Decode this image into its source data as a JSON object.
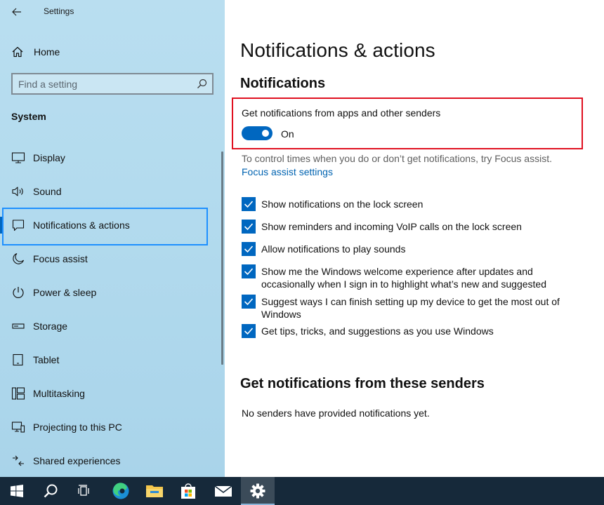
{
  "window": {
    "title": "Settings"
  },
  "sidebar": {
    "home_label": "Home",
    "search_placeholder": "Find a setting",
    "section_label": "System",
    "items": [
      {
        "label": "Display",
        "icon": "monitor-icon"
      },
      {
        "label": "Sound",
        "icon": "speaker-icon"
      },
      {
        "label": "Notifications & actions",
        "icon": "notification-icon",
        "selected": true
      },
      {
        "label": "Focus assist",
        "icon": "moon-icon"
      },
      {
        "label": "Power & sleep",
        "icon": "power-icon"
      },
      {
        "label": "Storage",
        "icon": "storage-icon"
      },
      {
        "label": "Tablet",
        "icon": "tablet-icon"
      },
      {
        "label": "Multitasking",
        "icon": "multitasking-icon"
      },
      {
        "label": "Projecting to this PC",
        "icon": "projecting-icon"
      },
      {
        "label": "Shared experiences",
        "icon": "shared-experiences-icon"
      }
    ]
  },
  "main": {
    "page_title": "Notifications & actions",
    "section_title": "Notifications",
    "toggle": {
      "caption": "Get notifications from apps and other senders",
      "state_label": "On",
      "on": true
    },
    "focus_hint": "To control times when you do or don’t get notifications, try Focus assist.",
    "focus_link": "Focus assist settings",
    "checkboxes": [
      {
        "label": "Show notifications on the lock screen",
        "checked": true
      },
      {
        "label": "Show reminders and incoming VoIP calls on the lock screen",
        "checked": true
      },
      {
        "label": "Allow notifications to play sounds",
        "checked": true
      },
      {
        "label": "Show me the Windows welcome experience after updates and occasionally when I sign in to highlight what’s new and suggested",
        "checked": true
      },
      {
        "label": "Suggest ways I can finish setting up my device to get the most out of Windows",
        "checked": true
      },
      {
        "label": "Get tips, tricks, and suggestions as you use Windows",
        "checked": true
      }
    ],
    "senders_title": "Get notifications from these senders",
    "senders_empty": "No senders have provided notifications yet."
  },
  "taskbar": {
    "items": [
      "windows-start-icon",
      "search-icon",
      "task-view-icon",
      "edge-icon",
      "file-explorer-icon",
      "store-icon",
      "mail-icon",
      "settings-gear-icon"
    ],
    "active": "settings-gear-icon"
  },
  "colors": {
    "accent": "#0067c0",
    "sidebar_bg": "#b3dbee",
    "highlight_box": "#e01020",
    "selection_box": "#1e90ff",
    "taskbar_bg": "#16293a"
  }
}
